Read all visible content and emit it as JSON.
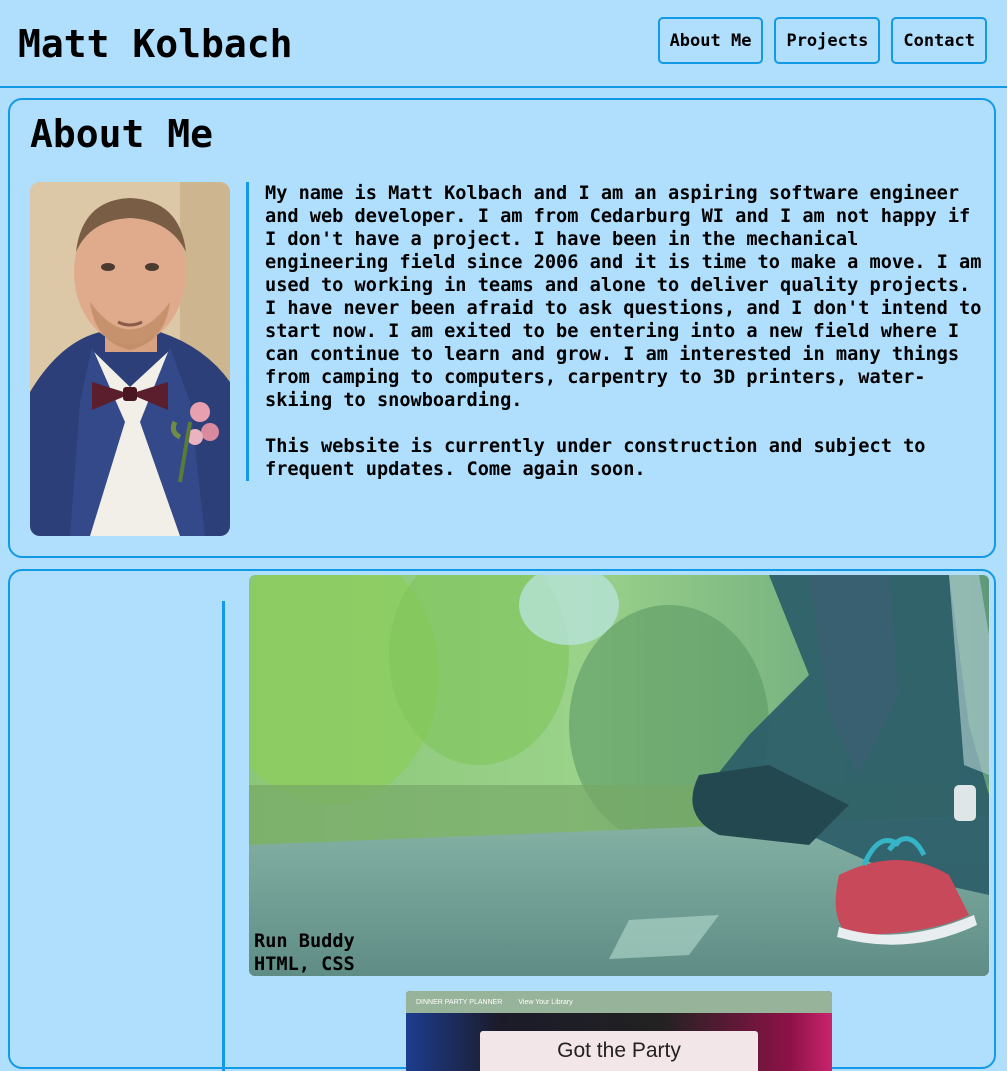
{
  "header": {
    "name": "Matt Kolbach",
    "nav": [
      {
        "label": "About Me"
      },
      {
        "label": "Projects"
      },
      {
        "label": "Contact"
      }
    ]
  },
  "about": {
    "heading": "About Me",
    "paragraphs": [
      "My name is Matt Kolbach and I am an aspiring software engineer and web developer. I am from Cedarburg WI and I am not happy if I don't have a project. I have been in the mechanical engineering field since 2006 and it is time to make a move. I am used to working in teams and alone to deliver quality projects. I have never been afraid to ask questions, and I don't intend to start now. I am exited to be entering into a new field where I can continue to learn and grow. I am interested in many things from camping to computers, carpentry to 3D printers, water-skiing to snowboarding.",
      "This website is currently under construction and subject to frequent updates. Come again soon."
    ]
  },
  "projects": [
    {
      "title": "Run Buddy",
      "tech": "HTML, CSS"
    },
    {
      "nav_title": "DINNER PARTY PLANNER",
      "nav_link": "View Your Library",
      "heading": "Got the Party"
    }
  ],
  "colors": {
    "background": "#b0defd",
    "accent": "#129ae6"
  }
}
